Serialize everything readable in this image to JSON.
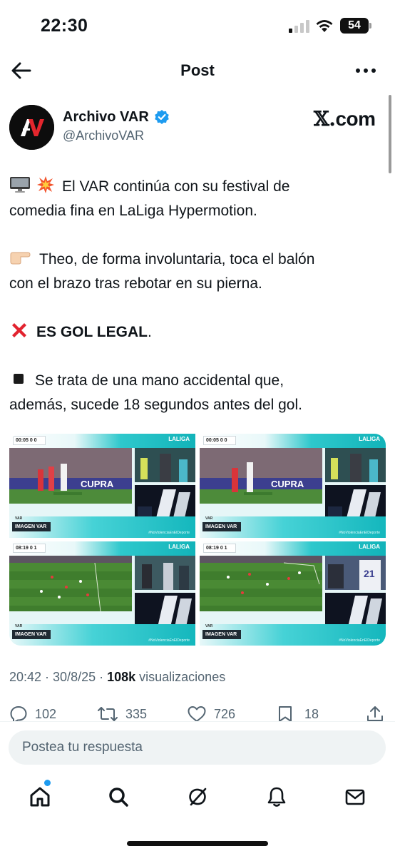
{
  "status_bar": {
    "time": "22:30",
    "battery": "54"
  },
  "header": {
    "title": "Post"
  },
  "author": {
    "name": "Archivo VAR",
    "handle": "@ArchivoVAR",
    "watermark": "com",
    "watermark_x": "𝕏."
  },
  "tweet": {
    "line1a": "El VAR continúa con su festival de",
    "line1b": "comedia fina en LaLiga Hypermotion.",
    "line2a": "Theo, de forma involuntaria, toca el balón",
    "line2b": "con el brazo tras rebotar en su pierna.",
    "line3_bold": "ES GOL LEGAL",
    "line3_tail": ".",
    "line4a": "Se trata de una mano accidental que,",
    "line4b": "además, sucede 18 segundos antes del gol."
  },
  "media": {
    "panels": [
      {
        "score": "00:05  0  0",
        "imagen": "IMAGEN VAR",
        "liga": "LALIGA",
        "var": "VAR",
        "hashtag": "#NoViolenciaEnElDeporte"
      },
      {
        "score": "00:05  0  0",
        "imagen": "IMAGEN VAR",
        "liga": "LALIGA",
        "var": "VAR",
        "hashtag": "#NoViolenciaEnElDeporte"
      },
      {
        "score": "08:19  0  1",
        "imagen": "IMAGEN VAR",
        "liga": "LALIGA",
        "var": "VAR",
        "hashtag": "#NoViolenciaEnElDeporte"
      },
      {
        "score": "08:19  0  1",
        "imagen": "IMAGEN VAR",
        "liga": "LALIGA",
        "var": "VAR",
        "hashtag": "#NoViolenciaEnElDeporte"
      }
    ]
  },
  "meta": {
    "time": "20:42 · 30/8/25 · ",
    "views_count": "108k",
    "views_label": " visualizaciones"
  },
  "actions": {
    "replies": "102",
    "reposts": "335",
    "likes": "726",
    "bookmarks": "18"
  },
  "reply": {
    "placeholder": "Postea tu respuesta"
  },
  "nav": {
    "active": "home"
  },
  "colors": {
    "accent": "#1d9bf0",
    "teal": "#14b7bd",
    "muted": "#536471"
  }
}
